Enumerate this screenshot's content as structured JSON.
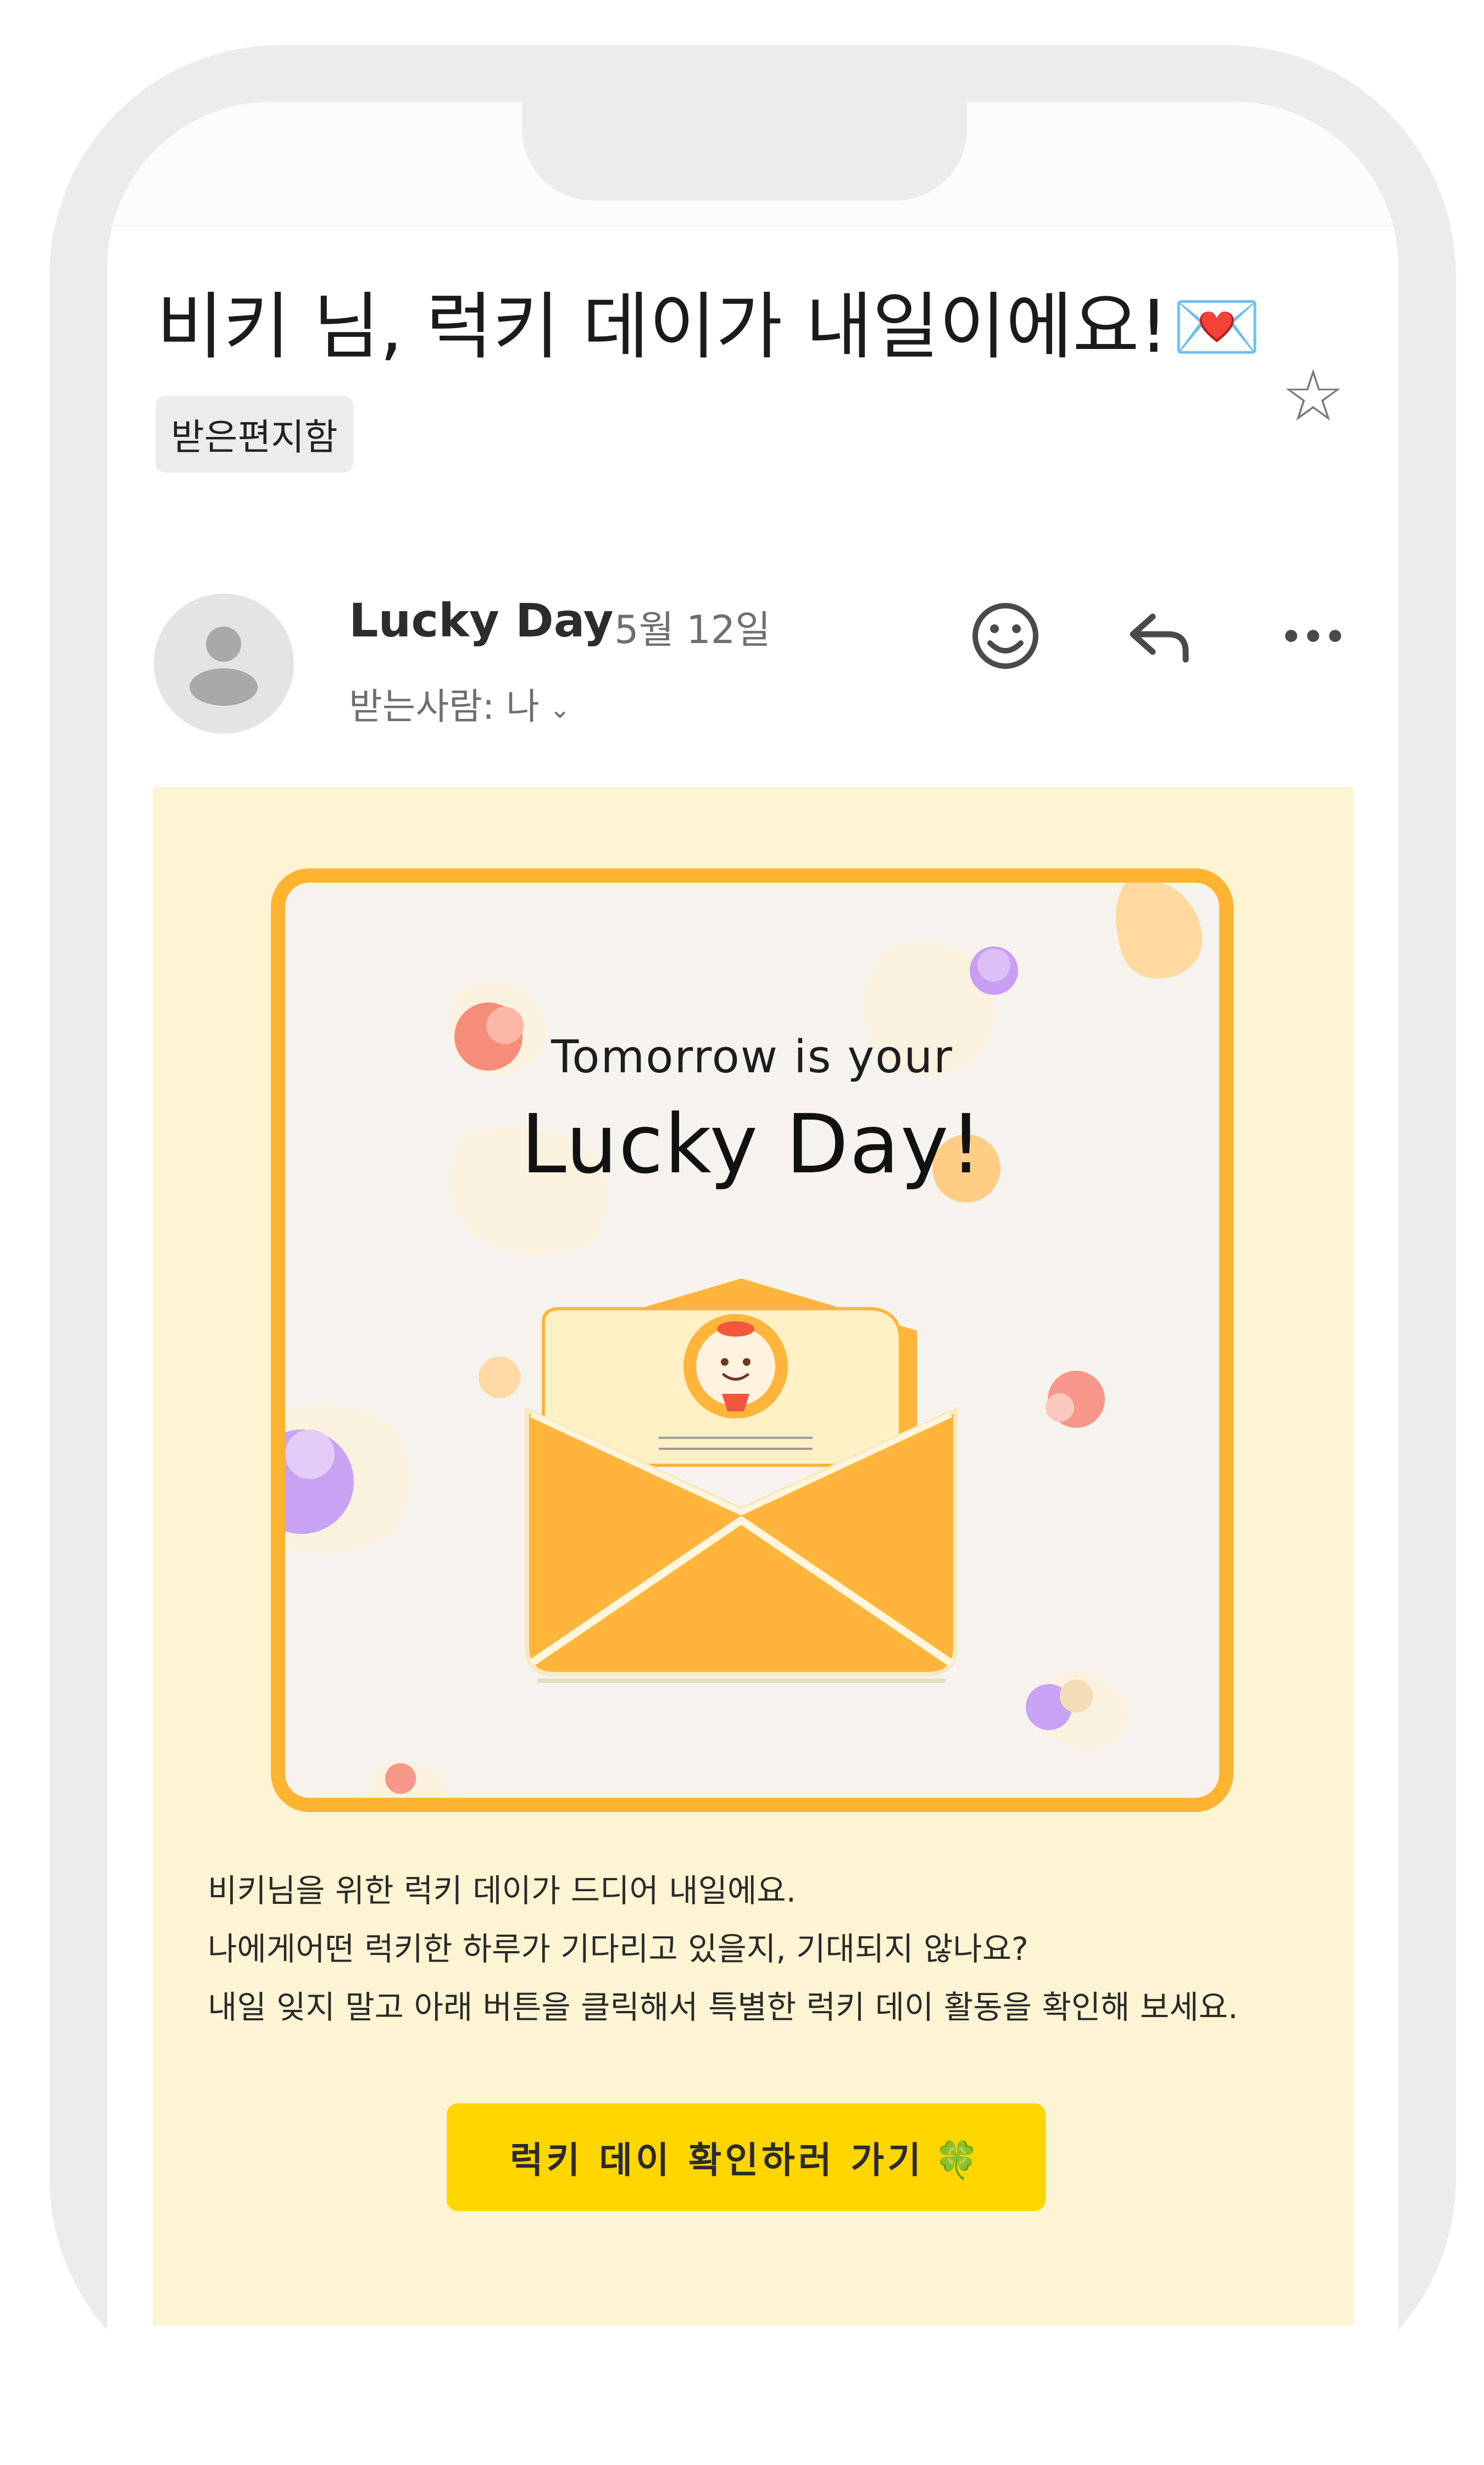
{
  "email": {
    "subject": "비키 님, 럭키 데이가 내일이에요!",
    "subject_emoji": "💌",
    "folder": "받은편지함",
    "sender_name": "Lucky Day",
    "date": "5월 12일",
    "recipients_label": "받는사람: 나"
  },
  "icons": {
    "star": "star-icon",
    "reaction": "smiley-icon",
    "reply": "reply-arrow-icon",
    "more": "more-horizontal-icon",
    "cta": "four-leaf-clover-icon"
  },
  "hero": {
    "line1": "Tomorrow is your",
    "line2": "Lucky Day!"
  },
  "body": {
    "paragraphs": [
      "비키님을 위한 럭키 데이가 드디어 내일에요.",
      "나에게어떤 럭키한 하루가 기다리고 있을지, 기대되지 않나요?",
      "내일 잊지 말고 아래 버튼을 클릭해서 특별한 럭키 데이 활동을 확인해 보세요."
    ]
  },
  "cta": {
    "label": "럭키 데이 확인하러 가기",
    "emoji": "🍀"
  },
  "colors": {
    "body_background": "#fdf4d3",
    "card_border": "#ffb431",
    "envelope": "#ffb53c",
    "cta_background": "#ffd600"
  }
}
